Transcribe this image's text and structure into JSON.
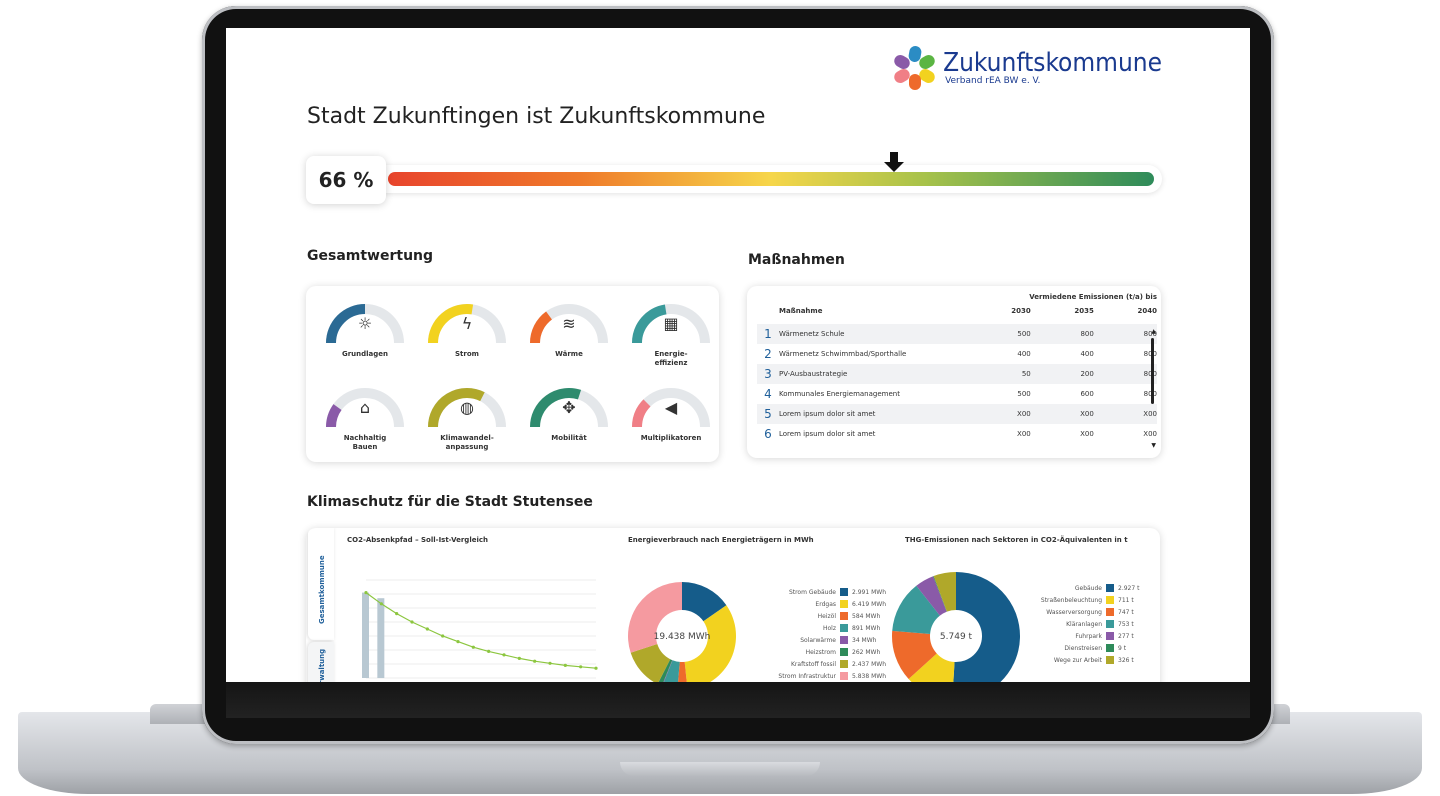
{
  "header": {
    "logo_name": "Zukunftskommune",
    "logo_sub": "Verband rEA BW e. V.",
    "title": "Stadt Zukunftingen ist Zukunftskommune",
    "progress_label": "66 %",
    "progress_value": 0.66
  },
  "gesamtwertung": {
    "heading": "Gesamtwertung",
    "gauges": [
      {
        "label": "Grundlagen",
        "value": 0.5,
        "color": "#2b6a94",
        "icon": "lightbulb-icon",
        "glyph": "☼"
      },
      {
        "label": "Strom",
        "value": 0.55,
        "color": "#f2d21f",
        "icon": "lightning-icon",
        "glyph": "ϟ"
      },
      {
        "label": "Wärme",
        "value": 0.3,
        "color": "#ee6a2b",
        "icon": "heat-waves-icon",
        "glyph": "≋"
      },
      {
        "label": "Energie-\neffizienz",
        "value": 0.45,
        "color": "#3a9a9a",
        "icon": "building-efficiency-icon",
        "glyph": "▦"
      },
      {
        "label": "Nachhaltig\nBauen",
        "value": 0.2,
        "color": "#8a5aa8",
        "icon": "house-leaf-icon",
        "glyph": "⌂"
      },
      {
        "label": "Klimawandel-\nanpassung",
        "value": 0.65,
        "color": "#b0a82a",
        "icon": "globe-icon",
        "glyph": "◍"
      },
      {
        "label": "Mobilität",
        "value": 0.6,
        "color": "#2e8b6e",
        "icon": "signpost-icon",
        "glyph": "✥"
      },
      {
        "label": "Multiplikatoren",
        "value": 0.25,
        "color": "#f07f86",
        "icon": "megaphone-icon",
        "glyph": "◀"
      }
    ]
  },
  "massnahmen": {
    "heading": "Maßnahmen",
    "header_group": "Vermiedene Emissionen (t/a) bis",
    "col_name": "Maßnahme",
    "col_years": [
      "2030",
      "2035",
      "2040"
    ],
    "rows": [
      {
        "n": "1",
        "name": "Wärmenetz Schule",
        "v": [
          "500",
          "800",
          "800"
        ]
      },
      {
        "n": "2",
        "name": "Wärmenetz Schwimmbad/Sporthalle",
        "v": [
          "400",
          "400",
          "800"
        ]
      },
      {
        "n": "3",
        "name": "PV-Ausbaustrategie",
        "v": [
          "50",
          "200",
          "800"
        ]
      },
      {
        "n": "4",
        "name": "Kommunales Energiemanagement",
        "v": [
          "500",
          "600",
          "800"
        ]
      },
      {
        "n": "5",
        "name": "Lorem ipsum dolor sit amet",
        "v": [
          "X00",
          "X00",
          "X00"
        ]
      },
      {
        "n": "6",
        "name": "Lorem ipsum dolor sit amet",
        "v": [
          "X00",
          "X00",
          "X00"
        ]
      }
    ]
  },
  "klimaschutz": {
    "heading": "Klimaschutz für die Stadt Stutensee",
    "tabs": [
      "Gesamtkommune",
      "Verwaltung"
    ],
    "chart_titles": [
      "CO2-Absenkpfad – Soll-Ist-Vergleich",
      "Energieverbrauch nach Energieträgern in MWh",
      "THG-Emissionen nach Sektoren in CO2-Äquivalenten in t"
    ],
    "donut1_center": "19.438 MWh",
    "donut2_center": "5.749 t"
  },
  "chart_data": [
    {
      "type": "line",
      "title": "CO2-Absenkpfad – Soll-Ist-Vergleich",
      "x": [
        1,
        2,
        3,
        4,
        5,
        6,
        7,
        8,
        9,
        10,
        11,
        12,
        13,
        14,
        15,
        16
      ],
      "series": [
        {
          "values": [
            6100,
            5300,
            4600,
            4000,
            3500,
            3000,
            2600,
            2200,
            1900,
            1650,
            1400,
            1200,
            1050,
            900,
            800,
            700
          ],
          "color": "#8cc63f"
        }
      ],
      "bars": [
        {
          "x": 1,
          "value": 6100,
          "color": "#b8c8d2"
        },
        {
          "x": 2,
          "value": 5700,
          "color": "#b8c8d2"
        }
      ],
      "ylim": [
        0,
        7000
      ]
    },
    {
      "type": "pie",
      "title": "Energieverbrauch nach Energieträgern in MWh",
      "labels": [
        "Strom Gebäude",
        "Erdgas",
        "Heizöl",
        "Holz",
        "Solarwärme",
        "Heizstrom",
        "Kraftstoff fossil",
        "Strom Infrastruktur"
      ],
      "values": [
        2991,
        6419,
        584,
        891,
        34,
        262,
        2437,
        5838
      ],
      "display": [
        "2.991 MWh",
        "6.419 MWh",
        "584 MWh",
        "891 MWh",
        "34 MWh",
        "262 MWh",
        "2.437 MWh",
        "5.838 MWh"
      ],
      "colors": [
        "#155c8a",
        "#f2d21f",
        "#ee6a2b",
        "#3a9a9a",
        "#8a5aa8",
        "#2e8b5a",
        "#b0a82a",
        "#f59aa0"
      ]
    },
    {
      "type": "pie",
      "title": "THG-Emissionen nach Sektoren in CO2-Äquivalenten in t",
      "labels": [
        "Gebäude",
        "Straßenbeleuchtung",
        "Wasserversorgung",
        "Kläranlagen",
        "Fuhrpark",
        "Dienstreisen",
        "Wege zur Arbeit"
      ],
      "values": [
        2927,
        711,
        747,
        753,
        277,
        9,
        326
      ],
      "display": [
        "2.927 t",
        "711 t",
        "747 t",
        "753 t",
        "277 t",
        "9 t",
        "326 t"
      ],
      "colors": [
        "#155c8a",
        "#f2d21f",
        "#ee6a2b",
        "#3a9a9a",
        "#8a5aa8",
        "#2e8b5a",
        "#b0a82a"
      ]
    }
  ]
}
